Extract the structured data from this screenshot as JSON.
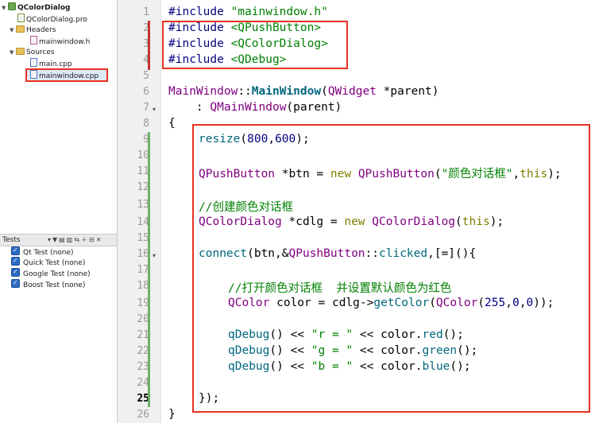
{
  "project_tree": {
    "project": "QColorDialog",
    "pro_file": "QColorDialog.pro",
    "headers_folder": "Headers",
    "header_file": "mainwindow.h",
    "sources_folder": "Sources",
    "source_main": "main.cpp",
    "source_mainwindow": "mainwindow.cpp"
  },
  "tests_panel": {
    "title": "Tests",
    "items": [
      {
        "label": "Qt Test (none)",
        "checked": true
      },
      {
        "label": "Quick Test (none)",
        "checked": true
      },
      {
        "label": "Google Test (none)",
        "checked": true
      },
      {
        "label": "Boost Test (none)",
        "checked": true
      }
    ]
  },
  "editor": {
    "current_line": 25,
    "line_numbers": [
      "1",
      "2",
      "3",
      "4",
      "5",
      "6",
      "7",
      "8",
      "9",
      "10",
      "11",
      "12",
      "13",
      "14",
      "15",
      "16",
      "17",
      "18",
      "19",
      "20",
      "21",
      "22",
      "23",
      "24",
      "25",
      "26"
    ],
    "lines": {
      "l1": [
        "#include ",
        "\"mainwindow.h\""
      ],
      "l2": [
        "#include ",
        "<QPushButton>"
      ],
      "l3": [
        "#include ",
        "<QColorDialog>"
      ],
      "l4": [
        "#include ",
        "<QDebug>"
      ],
      "l6": [
        "MainWindow",
        "::",
        "MainWindow",
        "(",
        "QWidget",
        " *parent)"
      ],
      "l7": [
        "    : ",
        "QMainWindow",
        "(parent)"
      ],
      "l8": [
        "{"
      ],
      "l9": [
        "resize",
        "(",
        "800",
        ",",
        "600",
        ");"
      ],
      "l11": [
        "QPushButton",
        " *btn = ",
        "new",
        " ",
        "QPushButton",
        "(",
        "\"颜色对话框\"",
        ",",
        "this",
        ");"
      ],
      "l13": [
        "//创建颜色对话框"
      ],
      "l14": [
        "QColorDialog",
        " *cdlg = ",
        "new",
        " ",
        "QColorDialog",
        "(",
        "this",
        ");"
      ],
      "l16": [
        "connect",
        "(btn,&",
        "QPushButton",
        "::",
        "clicked",
        ",[=](){"
      ],
      "l18": [
        "//打开颜色对话框  并设置默认颜色为红色"
      ],
      "l19": [
        "QColor",
        " color = cdlg->",
        "getColor",
        "(",
        "QColor",
        "(",
        "255",
        ",",
        "0",
        ",",
        "0",
        "));"
      ],
      "l21": [
        "qDebug",
        "() << ",
        "\"r = \"",
        " << color.",
        "red",
        "();"
      ],
      "l22": [
        "qDebug",
        "() << ",
        "\"g = \"",
        " << color.",
        "green",
        "();"
      ],
      "l23": [
        "qDebug",
        "() << ",
        "\"b = \"",
        " << color.",
        "blue",
        "();"
      ],
      "l25": [
        "});"
      ],
      "l26": [
        "}"
      ]
    }
  },
  "colors": {
    "highlight_box": "#e8321e",
    "keyword": "#808000",
    "string": "#008000",
    "class": "#800080",
    "function": "#00677c",
    "number": "#000080"
  }
}
